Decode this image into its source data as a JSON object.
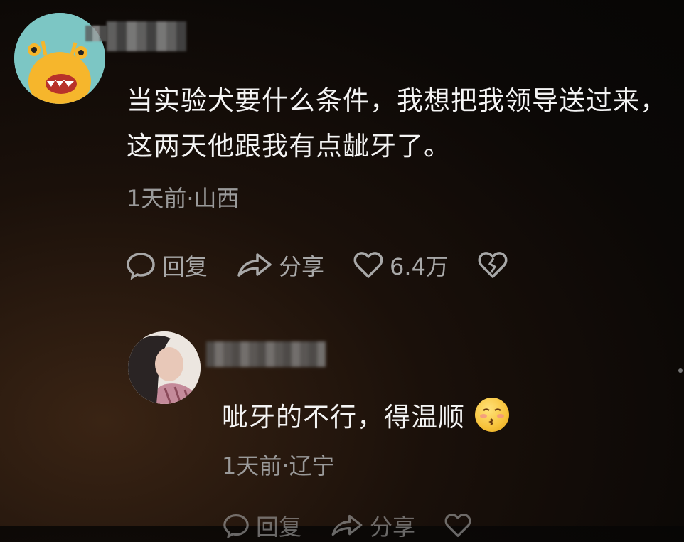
{
  "comment": {
    "avatar": "cartoon-monster-avatar",
    "text": "当实验犬要什么条件，我想把我领导送过来，这两天他跟我有点龇牙了。",
    "meta": "1天前·山西",
    "actions": {
      "reply_label": "回复",
      "share_label": "分享",
      "like_count": "6.4万"
    }
  },
  "reply": {
    "avatar": "user-photo-avatar",
    "text": "呲牙的不行，得温顺",
    "emoji": "kissing-face-emoji",
    "meta": "1天前·辽宁",
    "actions": {
      "reply_label": "回复",
      "share_label": "分享"
    }
  },
  "colors": {
    "text": "#f4f4f4",
    "meta": "#9a9a9a",
    "icon": "#a8a8a8"
  }
}
